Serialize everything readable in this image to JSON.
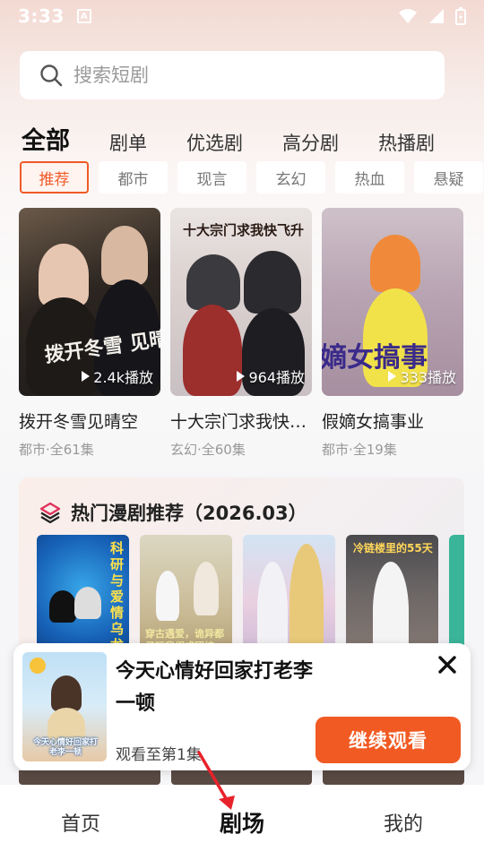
{
  "status_bar": {
    "time": "3:33"
  },
  "search": {
    "placeholder": "搜索短剧"
  },
  "category_tabs": [
    {
      "label": "全部",
      "active": true
    },
    {
      "label": "剧单",
      "active": false
    },
    {
      "label": "优选剧",
      "active": false
    },
    {
      "label": "高分剧",
      "active": false
    },
    {
      "label": "热播剧",
      "active": false
    }
  ],
  "genre_chips": [
    {
      "label": "推荐",
      "active": true
    },
    {
      "label": "都市",
      "active": false
    },
    {
      "label": "现言",
      "active": false
    },
    {
      "label": "玄幻",
      "active": false
    },
    {
      "label": "热血",
      "active": false
    },
    {
      "label": "悬疑",
      "active": false
    }
  ],
  "dramas": [
    {
      "title": "拨开冬雪见晴空",
      "plays": "2.4k播放",
      "meta": "都市·全61集",
      "cover_text": "拨开冬雪 见晴空"
    },
    {
      "title": "十大宗门求我快…",
      "plays": "964播放",
      "meta": "玄幻·全60集",
      "cover_text": "十大宗门求我快飞升"
    },
    {
      "title": "假嫡女搞事业",
      "plays": "333播放",
      "meta": "都市·全19集",
      "cover_text": "嫡女搞事"
    }
  ],
  "recommend": {
    "title": "热门漫剧推荐（2026.03）",
    "cover_texts": [
      "科研与爱情乌龙",
      "穿古遇爱，诡异都子玩我们成团结",
      "",
      "冷链楼里的55天",
      ""
    ]
  },
  "popup": {
    "title": "今天心情好回家打老李一顿",
    "progress": "观看至第1集",
    "button": "继续观看",
    "thumb_text": "今天心情好回家打老李一顿"
  },
  "bottom_nav": [
    {
      "label": "首页",
      "active": false
    },
    {
      "label": "剧场",
      "active": true
    },
    {
      "label": "我的",
      "active": false
    }
  ],
  "colors": {
    "accent": "#f15a22",
    "chip_active": "#f05a28"
  }
}
